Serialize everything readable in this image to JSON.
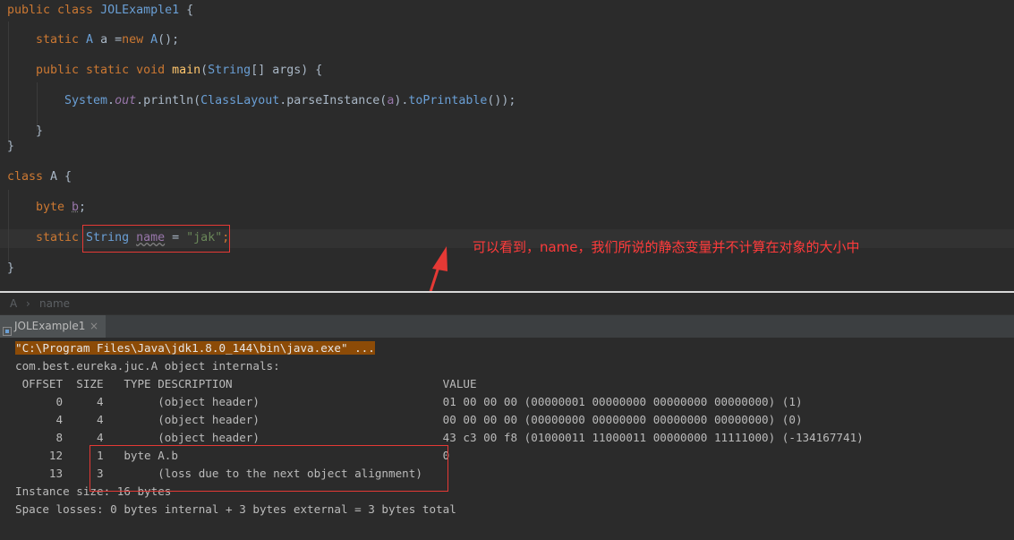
{
  "breadcrumb": {
    "class_name": "A",
    "member_name": "name",
    "separator": "›"
  },
  "run_tab": {
    "label": "JOLExample1",
    "close": "×"
  },
  "annotation": {
    "text": "可以看到，name，我们所说的静态变量并不计算在对象的大小中"
  },
  "code": {
    "l1": {
      "kw": "public class ",
      "cls": "JOLExample1",
      "rest": " {"
    },
    "l2": {
      "kw": "static ",
      "cls": "A",
      "plain1": " a =",
      "kw2": "new ",
      "cls2": "A",
      "rest": "();"
    },
    "l3": {
      "kw": "public static void ",
      "meth": "main",
      "p1": "(",
      "cls": "String",
      "p2": "[] args) {"
    },
    "l4": {
      "cls": "System",
      "dot1": ".",
      "fld": "out",
      "dot2": ".println(",
      "cls2": "ClassLayout",
      "dot3": ".parseInstance(",
      "a": "a",
      "dot4": ").",
      "mth": "toPrintable",
      "rest": "());"
    },
    "l5": "}",
    "l6": "}",
    "l7": {
      "kw": "class ",
      "plain": "A {"
    },
    "l8": {
      "kw": "byte ",
      "fld": "b",
      "rest": ";"
    },
    "l9": {
      "kw": "static ",
      "cls": "String",
      "sp": " ",
      "fld": "name",
      "eq": " = ",
      "str": "\"jak\"",
      "semi": ";"
    },
    "l10": "}"
  },
  "console": {
    "cmd": "\"C:\\Program Files\\Java\\jdk1.8.0_144\\bin\\java.exe\" ...",
    "header": "com.best.eureka.juc.A object internals:",
    "columns": " OFFSET  SIZE   TYPE DESCRIPTION                               VALUE",
    "rows": [
      "      0     4        (object header)                           01 00 00 00 (00000001 00000000 00000000 00000000) (1)",
      "      4     4        (object header)                           00 00 00 00 (00000000 00000000 00000000 00000000) (0)",
      "      8     4        (object header)                           43 c3 00 f8 (01000011 11000011 00000000 11111000) (-134167741)",
      "     12     1   byte A.b                                       0",
      "     13     3        (loss due to the next object alignment)"
    ],
    "instance_size": "Instance size: 16 bytes",
    "space_losses": "Space losses: 0 bytes internal + 3 bytes external = 3 bytes total"
  },
  "colors": {
    "highlight_box": "#e53935",
    "annotation": "#ff3b3b",
    "keyword": "#cc7832",
    "string": "#6a8759"
  }
}
